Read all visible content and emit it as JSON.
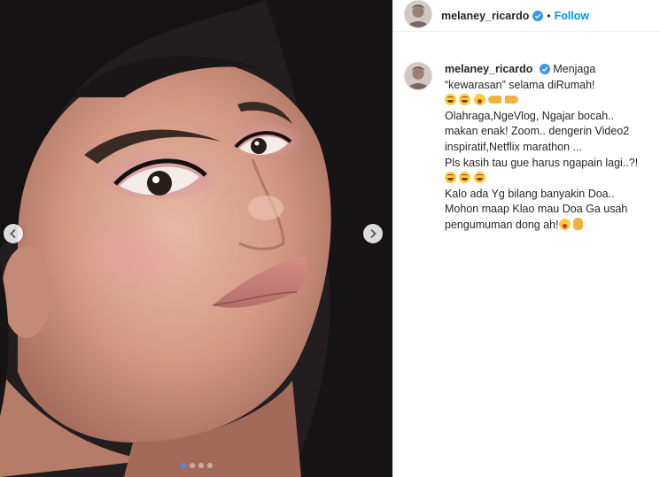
{
  "post": {
    "username": "melaney_ricardo",
    "separator": "•",
    "follow_label": "Follow",
    "caption": {
      "username": "melaney_ricardo",
      "line1": "Menjaga",
      "line2": "“kewarasan” selama diRumah!",
      "line3_emojis": [
        "rofl-emoji",
        "rofl-emoji",
        "astonished-emoji",
        "left-hand-emoji",
        "right-hand-emoji"
      ],
      "line4": "Olahraga,NgeVlog, Ngajar bocah..",
      "line5": "makan enak! Zoom.. dengerin Video2",
      "line6": "inspiratif,Netflix marathon ...",
      "line7": "Pls kasih tau gue harus ngapain lagi..?!",
      "line8_emojis": [
        "rofl-emoji",
        "rofl-emoji",
        "rofl-emoji"
      ],
      "line9": "Kalo ada Yg bilang banyakin Doa..",
      "line10": "Mohon maap Klao mau Doa Ga usah",
      "line11": "pengumuman dong ah!",
      "line11_emojis": [
        "astonished-emoji",
        "ok-hand-emoji"
      ]
    }
  },
  "carousel": {
    "total": 4,
    "active_index": 0
  },
  "colors": {
    "follow": "#0095f6",
    "verified": "#3897f0",
    "text": "#262626",
    "active_dot": "#3897f0"
  }
}
